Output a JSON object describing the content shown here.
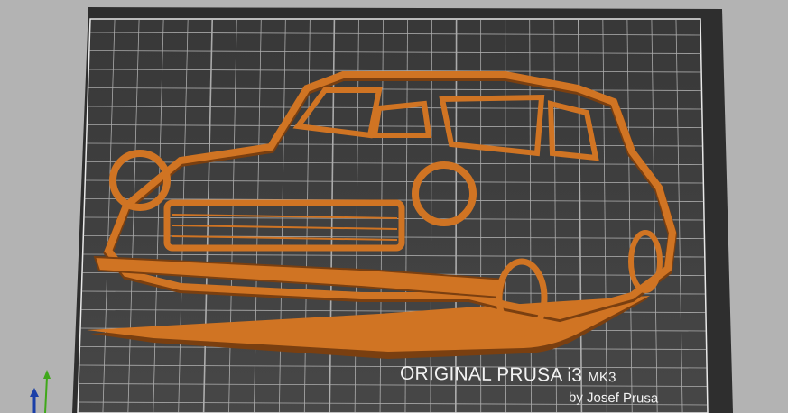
{
  "viewport": {
    "title": "3D view - print bed"
  },
  "bed": {
    "brand_main": "ORIGINAL PRUSA i3",
    "brand_model": "MK3",
    "byline": "by Josef Prusa"
  },
  "model": {
    "name": "car wall art",
    "color": "#d07423",
    "shadow_color": "#7a3f10"
  },
  "colors": {
    "background": "#b3b3b3",
    "bed": "#3c3c3c",
    "grid": "#d8d8d8",
    "axis_z": "#1a3fa8",
    "axis_y": "#3fa81a"
  }
}
